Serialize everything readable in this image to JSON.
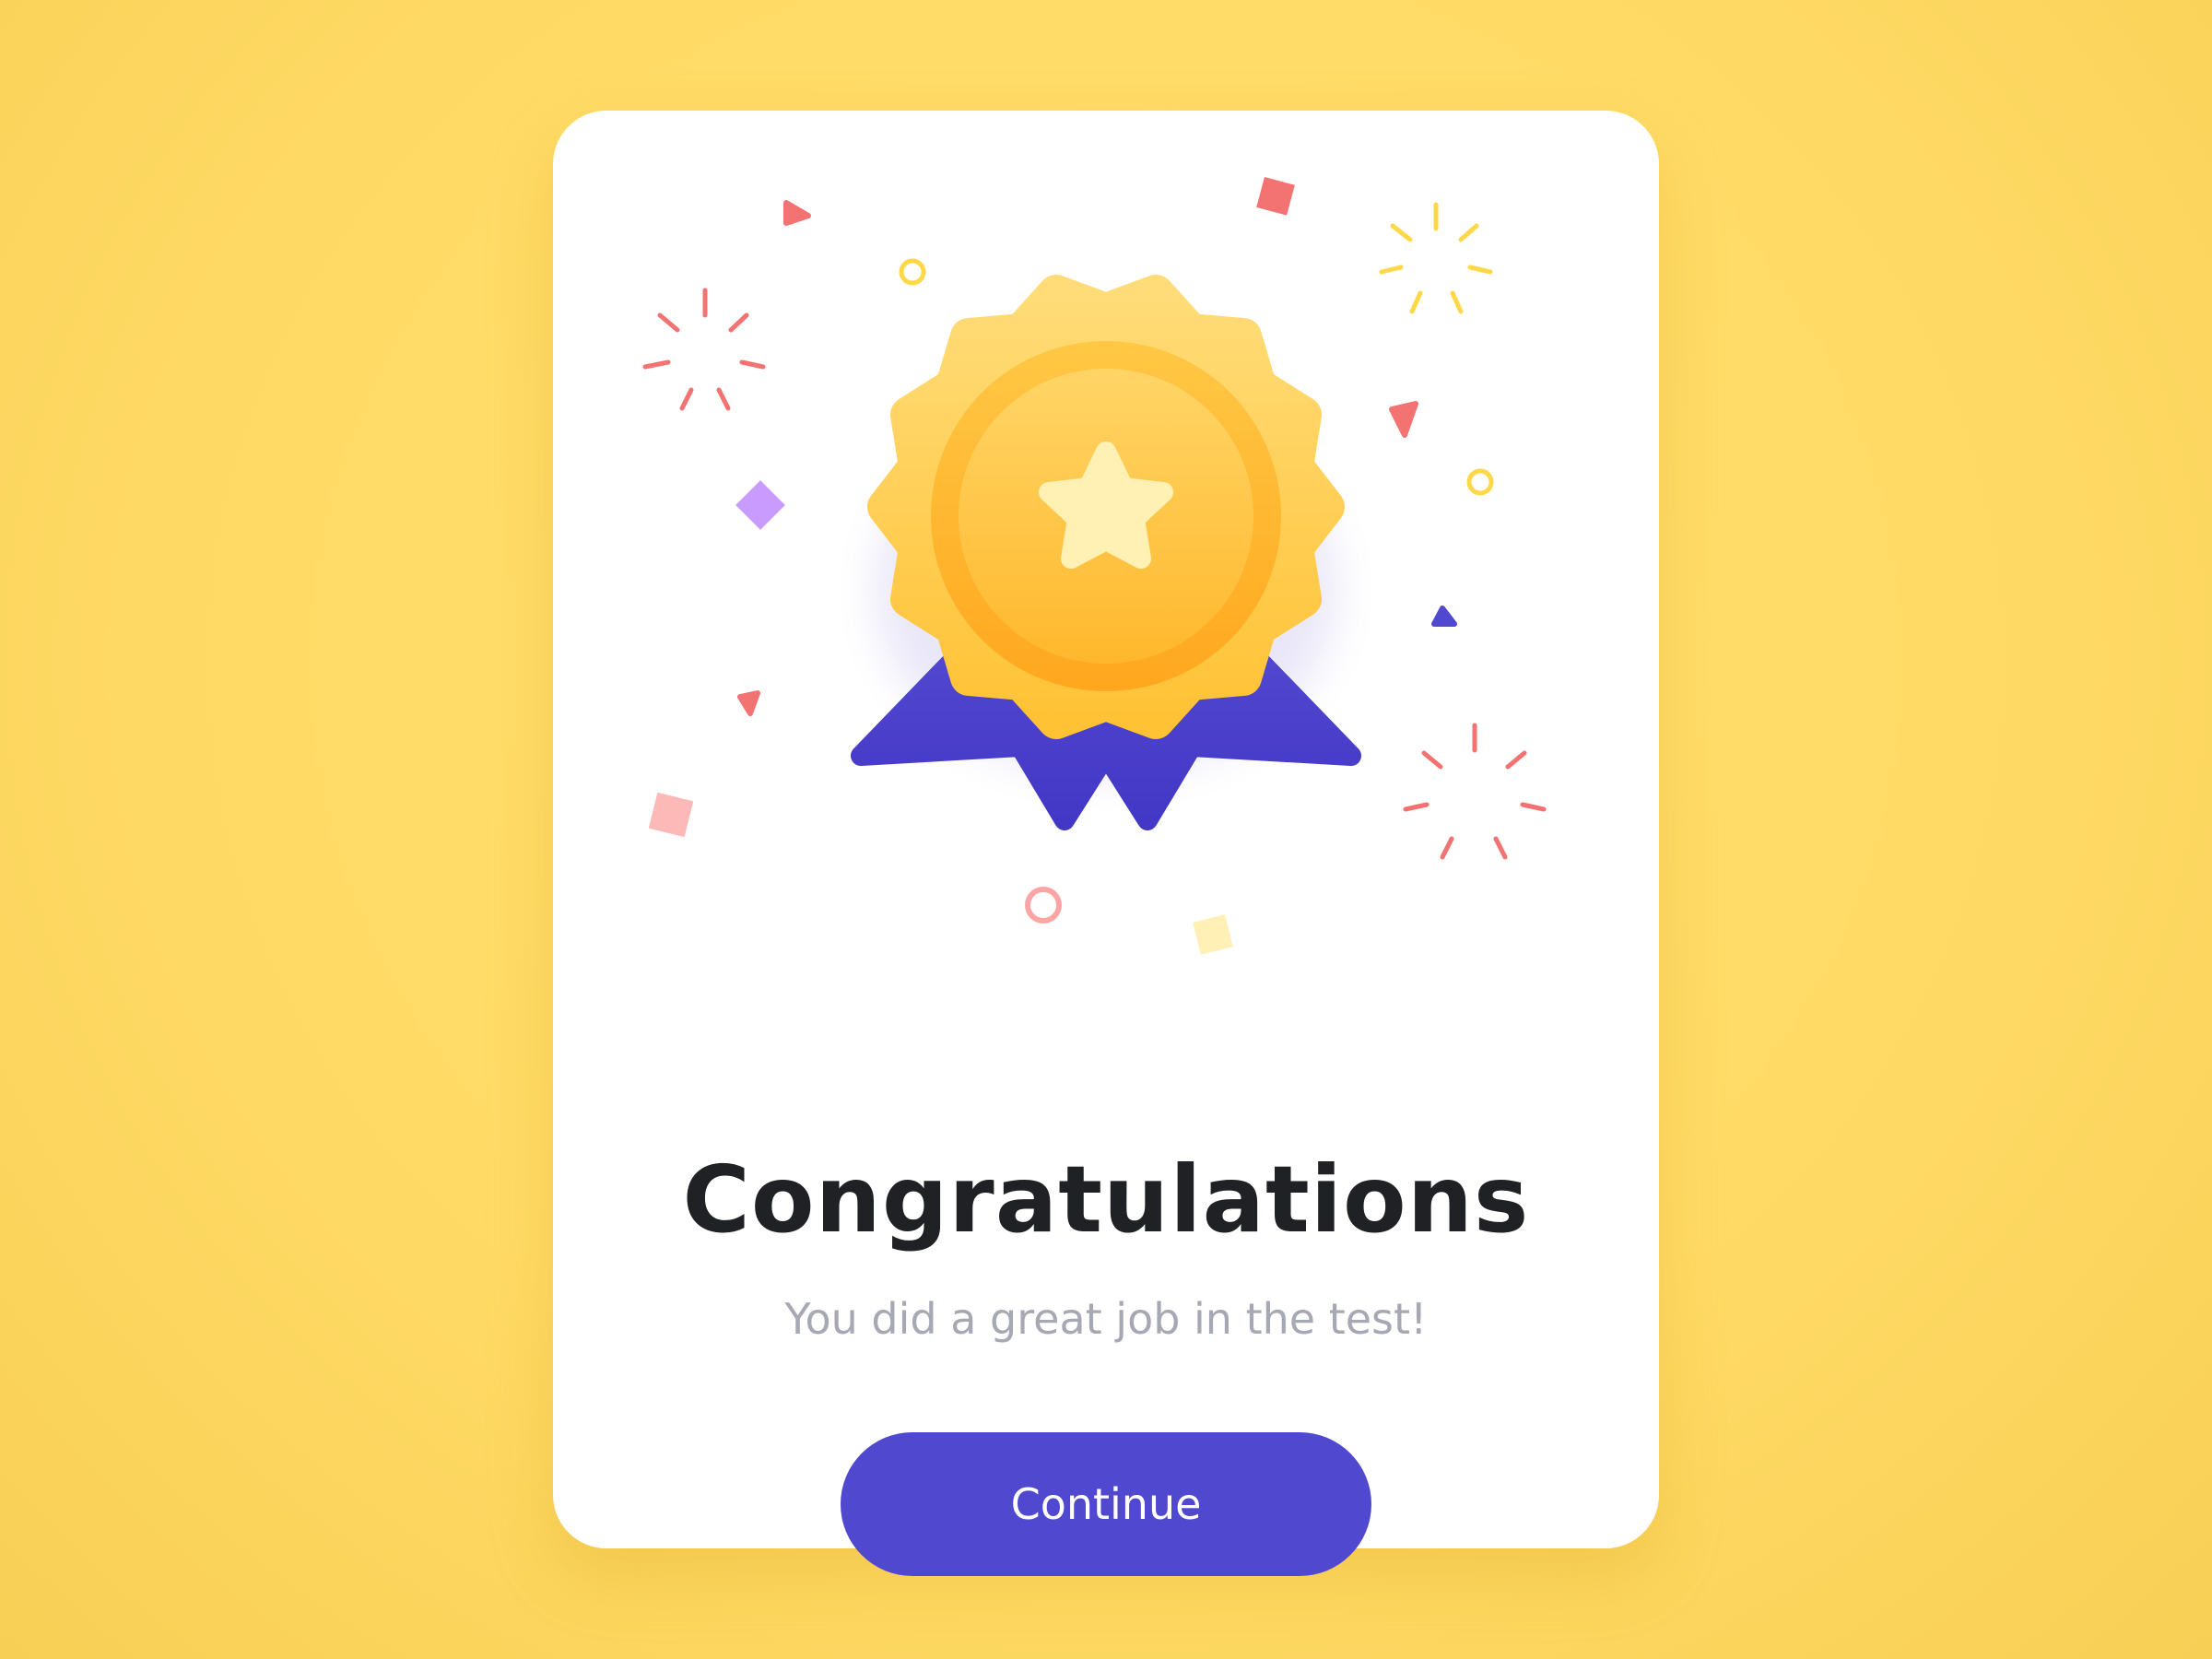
{
  "dialog": {
    "title": "Congratulations",
    "subtitle": "You did a great job in the test!",
    "continue_label": "Continue"
  },
  "icons": {
    "medal": "medal-badge-icon",
    "star": "star-icon",
    "confetti": "confetti-decoration"
  },
  "colors": {
    "background": "#FFDB66",
    "card": "#FFFFFF",
    "accent": "#5048CF",
    "medal_gold": "#FFC43D",
    "title_text": "#202124",
    "subtitle_text": "#A6A8B3"
  }
}
